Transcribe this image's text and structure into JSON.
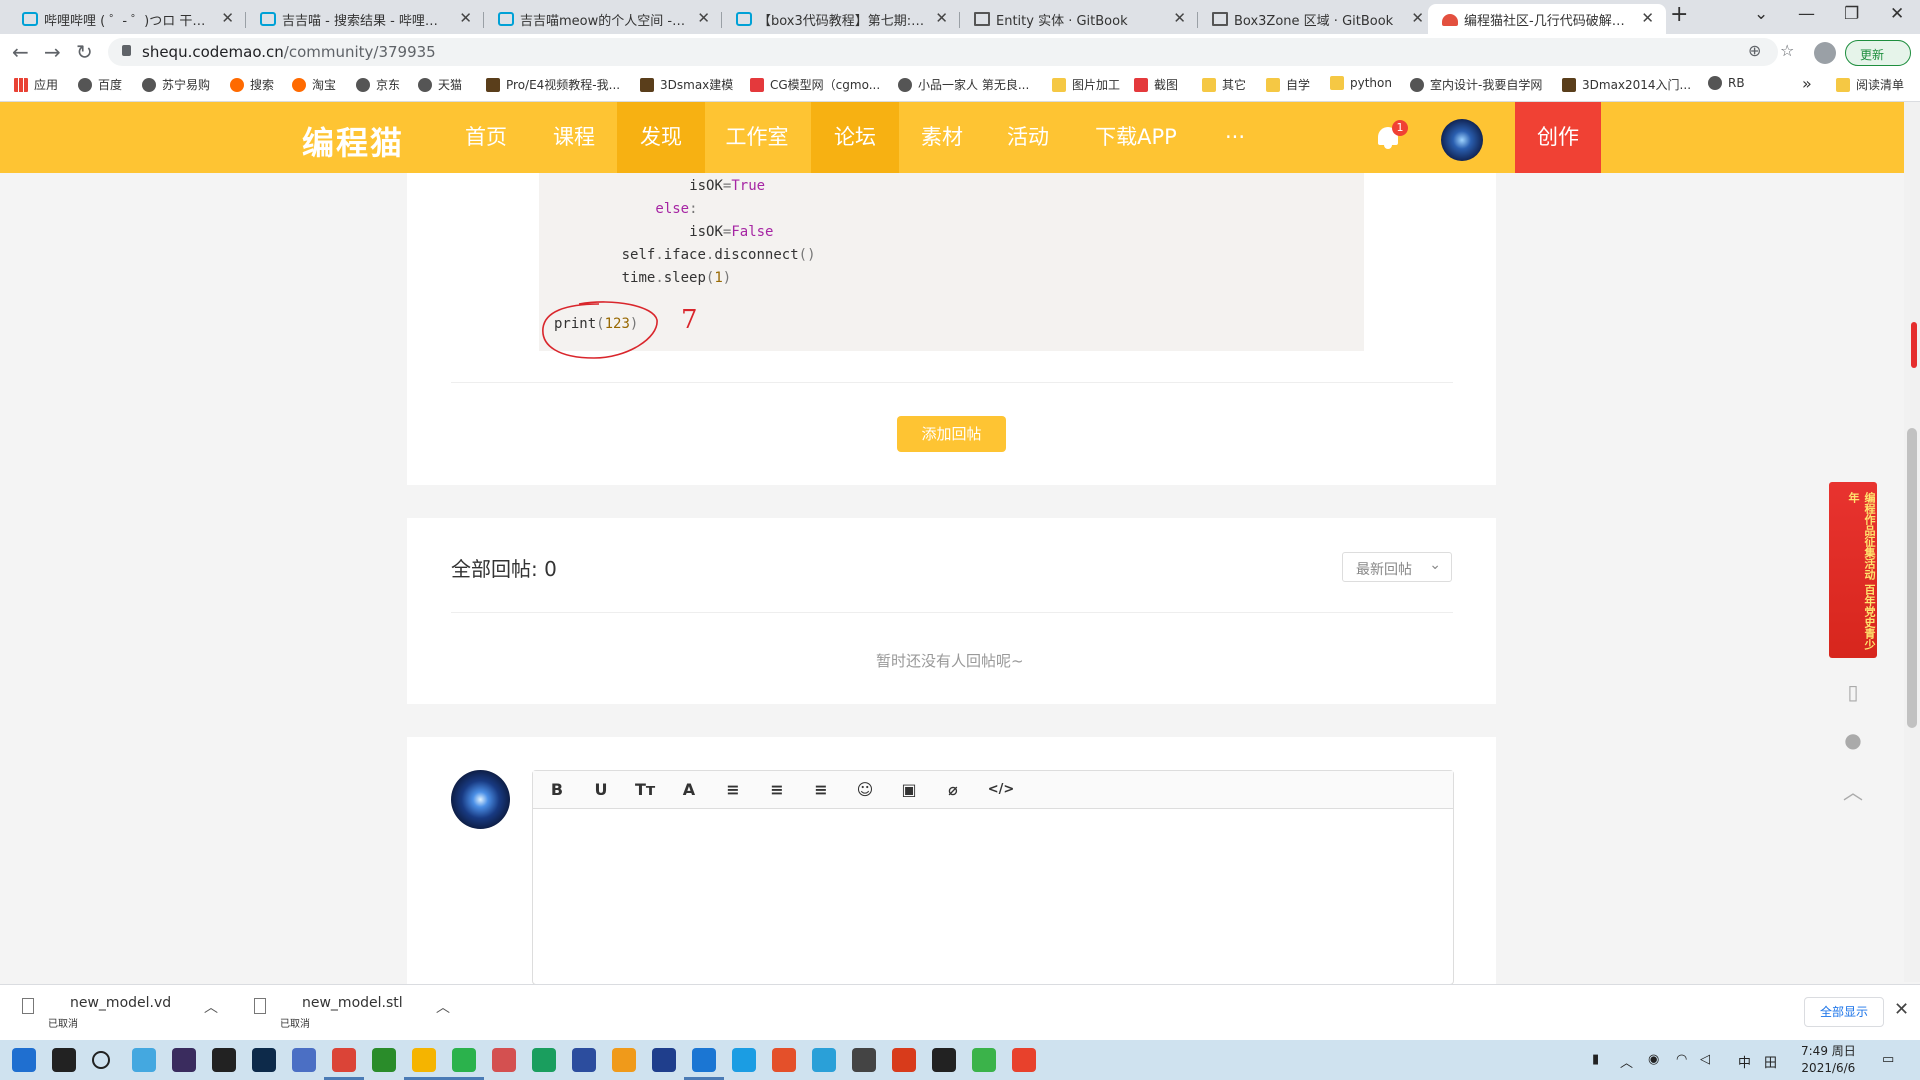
{
  "browser": {
    "tabs": [
      {
        "title": "哔哩哔哩 ( ゜- ゜)つロ 干杯~-bili",
        "favicon": "bilibili-icon"
      },
      {
        "title": "吉吉喵 - 搜索结果 - 哔哩哔哩弹",
        "favicon": "bilibili-icon"
      },
      {
        "title": "吉吉喵meow的个人空间 - 哔哩",
        "favicon": "bilibili-icon"
      },
      {
        "title": "【box3代码教程】第七期: 如何",
        "favicon": "bilibili-icon"
      },
      {
        "title": "Entity 实体 · GitBook",
        "favicon": "book-icon"
      },
      {
        "title": "Box3Zone 区域 · GitBook",
        "favicon": "book-icon"
      },
      {
        "title": "编程猫社区-几行代码破解WiFi密",
        "favicon": "codemao-icon"
      }
    ],
    "active_tab": 6,
    "new_tab_label": "+",
    "url_domain": "shequ.codemao.cn",
    "url_path": "/community/379935",
    "update_label": "更新",
    "bookmarks": [
      {
        "label": "应用",
        "icon": "apps-grid-icon"
      },
      {
        "label": "百度",
        "icon": "globe-icon"
      },
      {
        "label": "苏宁易购",
        "icon": "globe-icon"
      },
      {
        "label": "搜索",
        "icon": "search-icon"
      },
      {
        "label": "淘宝",
        "icon": "taobao-icon"
      },
      {
        "label": "京东",
        "icon": "globe-icon"
      },
      {
        "label": "天猫",
        "icon": "globe-icon"
      },
      {
        "label": "Pro/E4视频教程-我...",
        "icon": "v-icon"
      },
      {
        "label": "3Dsmax建模",
        "icon": "v-icon"
      },
      {
        "label": "CG模型网（cgmo...",
        "icon": "cg-icon"
      },
      {
        "label": "小品一家人 第无良...",
        "icon": "play-icon"
      },
      {
        "label": "图片加工",
        "icon": "folder-icon"
      },
      {
        "label": "截图",
        "icon": "weibo-icon"
      },
      {
        "label": "其它",
        "icon": "folder-icon"
      },
      {
        "label": "自学",
        "icon": "folder-icon"
      },
      {
        "label": "python",
        "icon": "folder-icon"
      },
      {
        "label": "室内设计-我要自学网",
        "icon": "globe-icon"
      },
      {
        "label": "3Dmax2014入门...",
        "icon": "v-icon"
      },
      {
        "label": "RB",
        "icon": "globe-icon"
      }
    ],
    "reading_list_label": "阅读清单"
  },
  "site": {
    "logo": "编程猫",
    "nav": [
      {
        "label": "首页",
        "active": false
      },
      {
        "label": "课程",
        "active": false
      },
      {
        "label": "发现",
        "active": true
      },
      {
        "label": "工作室",
        "active": false
      },
      {
        "label": "论坛",
        "active": true
      },
      {
        "label": "素材",
        "active": false
      },
      {
        "label": "活动",
        "active": false
      },
      {
        "label": "下载APP",
        "active": false
      },
      {
        "label": "···",
        "active": false
      }
    ],
    "notification_count": "1",
    "create_label": "创作",
    "brand_color": "#fec433",
    "accent_color": "#f04134"
  },
  "post": {
    "code_lines": [
      {
        "indent": 16,
        "parts": [
          [
            "isOK",
            ""
          ],
          [
            "=",
            "op"
          ],
          [
            "True",
            "kw"
          ]
        ]
      },
      {
        "indent": 12,
        "parts": [
          [
            "else",
            "kw"
          ],
          [
            ":",
            "op"
          ]
        ]
      },
      {
        "indent": 16,
        "parts": [
          [
            "isOK",
            ""
          ],
          [
            "=",
            "op"
          ],
          [
            "False",
            "kw"
          ]
        ]
      },
      {
        "indent": 8,
        "parts": [
          [
            "self",
            ""
          ],
          [
            ".",
            "op"
          ],
          [
            "iface",
            ""
          ],
          [
            ".",
            "op"
          ],
          [
            "disconnect",
            ""
          ],
          [
            "()",
            "op"
          ]
        ]
      },
      {
        "indent": 8,
        "parts": [
          [
            "time",
            ""
          ],
          [
            ".",
            "op"
          ],
          [
            "sleep",
            ""
          ],
          [
            "(",
            "op"
          ],
          [
            "1",
            "num"
          ],
          [
            ")",
            "op"
          ]
        ]
      },
      {
        "indent": 0,
        "parts": [
          [
            "print",
            ""
          ],
          [
            "(",
            "op"
          ],
          [
            "123",
            "num"
          ],
          [
            ")",
            "op"
          ]
        ]
      }
    ],
    "annotation_number": "7",
    "add_reply_label": "添加回帖"
  },
  "replies": {
    "title": "全部回帖: 0",
    "sort_label": "最新回帖",
    "empty_text": "暂时还没有人回帖呢~"
  },
  "editor": {
    "toolbar": [
      "B",
      "U",
      "Tт",
      "A",
      "≡",
      "≡",
      "≡",
      "☺",
      "▣",
      "⌀",
      "</>"
    ]
  },
  "promo_text": "编程作品征集活动 百年党史青少年",
  "downloads": [
    {
      "name": "new_model.vd",
      "status": "已取消"
    },
    {
      "name": "new_model.stl",
      "status": "已取消"
    }
  ],
  "show_all_label": "全部显示",
  "clock": {
    "time": "7:49 周日",
    "date": "2021/6/6"
  },
  "tray": {
    "ime": "中",
    "layout": "田"
  }
}
